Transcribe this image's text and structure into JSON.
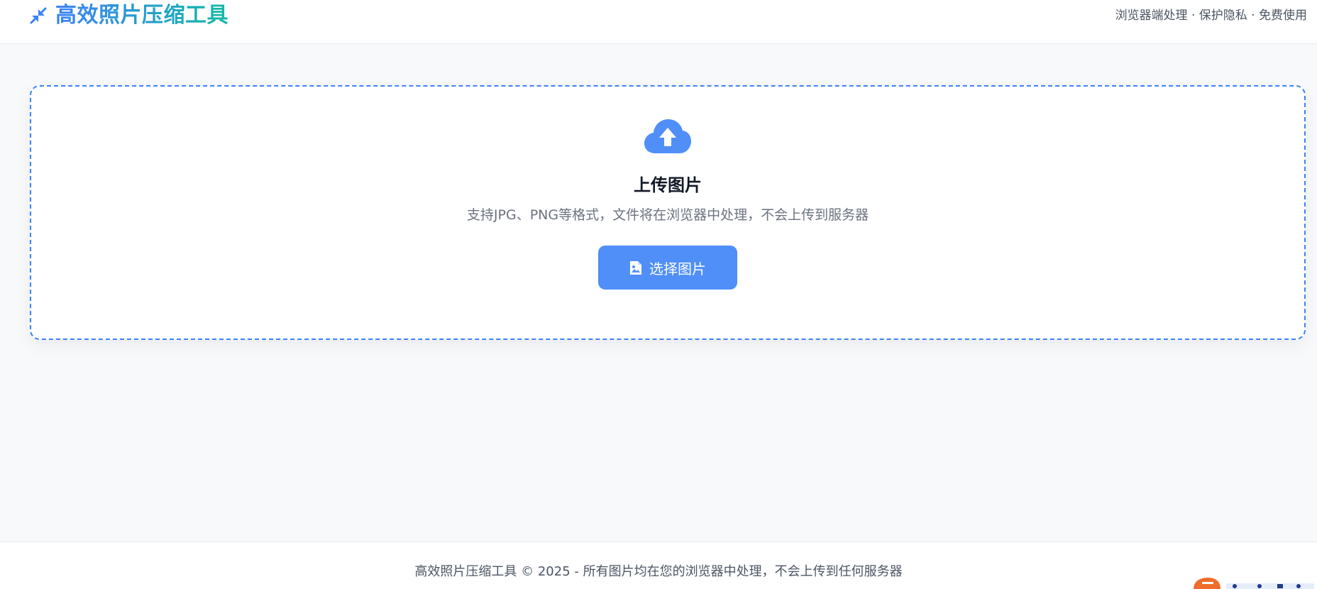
{
  "header": {
    "title": "高效照片压缩工具",
    "tagline": "浏览器端处理 · 保护隐私 · 免费使用",
    "icon": "compress-arrows-icon"
  },
  "upload": {
    "icon": "cloud-upload-icon",
    "title": "上传图片",
    "description": "支持JPG、PNG等格式，文件将在浏览器中处理，不会上传到服务器",
    "button_label": "选择图片",
    "button_icon": "image-file-icon"
  },
  "footer": {
    "text": "高效照片压缩工具 © 2025 - 所有图片均在您的浏览器中处理，不会上传到任何服务器"
  },
  "colors": {
    "accent": "#3b82f6",
    "button": "#4f8ff7",
    "title_gradient_end": "#14b8a6",
    "background": "#f8f9fb"
  }
}
